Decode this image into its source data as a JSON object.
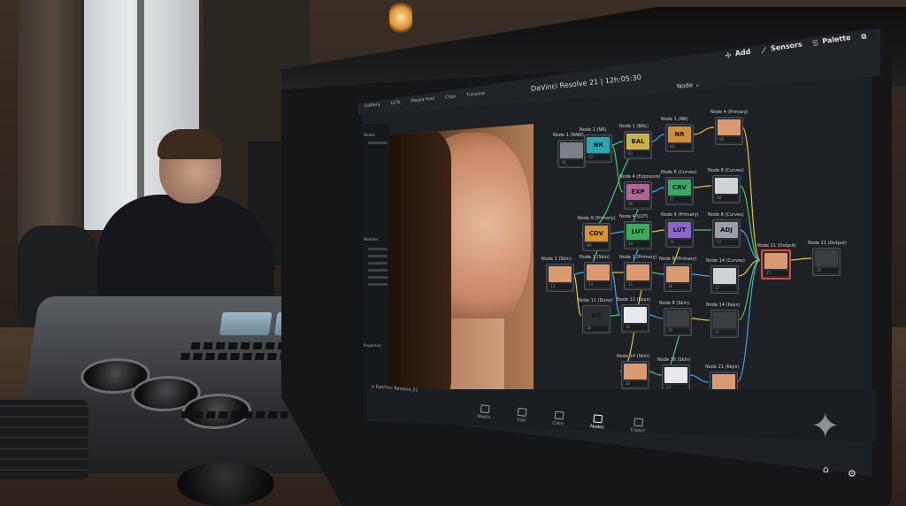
{
  "app": {
    "title": "DaVinci Resolve 21 | 12h:05:30",
    "view_title": "Node",
    "project_name": "DaVinci Resolve 21"
  },
  "menubar": {
    "items": [
      {
        "label": "Add",
        "icon": "plus-icon"
      },
      {
        "label": "Sensors",
        "icon": "sensors-icon"
      },
      {
        "label": "Palette",
        "icon": "palette-icon"
      }
    ]
  },
  "toolbar": {
    "items": [
      "Gallery",
      "LUTs",
      "Media Pool",
      "Clips",
      "Timeline"
    ]
  },
  "sidebar": {
    "header": "Nodes",
    "section_label": "Modules",
    "footer_label": "Properties"
  },
  "nodes": [
    {
      "label": "Node 1 (RAW)",
      "text": "",
      "color": "#7a8085",
      "foot": "01"
    },
    {
      "label": "Node 1 (NR)",
      "text": "NR",
      "color": "#2aa6b0",
      "foot": "02"
    },
    {
      "label": "Node 1 (BAL)",
      "text": "BAL",
      "color": "#c9b24a",
      "foot": "03"
    },
    {
      "label": "Node 1 (NR)",
      "text": "NR",
      "color": "#c9913a",
      "foot": "04"
    },
    {
      "label": "Node 4 (Primary)",
      "text": "",
      "color": "#d99a72",
      "foot": "05"
    },
    {
      "label": "Node 4 (Exposure)",
      "text": "EXP",
      "color": "#b1639a",
      "foot": "06"
    },
    {
      "label": "Node 6 (Curves)",
      "text": "CRV",
      "color": "#3aa865",
      "foot": "07"
    },
    {
      "label": "Node 8 (Curves)",
      "text": "",
      "color": "#cfd3d6",
      "foot": "08"
    },
    {
      "label": "Node 9 (Primary)",
      "text": "CDV",
      "color": "#d39338",
      "foot": "09"
    },
    {
      "label": "Node 4 (LUT)",
      "text": "LUT",
      "color": "#3cab5a",
      "foot": "10"
    },
    {
      "label": "Node 4 (Primary)",
      "text": "LUT",
      "color": "#8b67c8",
      "foot": "11"
    },
    {
      "label": "Node 8 (Curves)",
      "text": "ADJ",
      "color": "#9aa0a5",
      "foot": "12"
    },
    {
      "label": "Node 1 (Skin)",
      "text": "",
      "color": "#d99a72",
      "foot": "13"
    },
    {
      "label": "Node 1 (Skin)",
      "text": "",
      "color": "#d99a72",
      "foot": "14"
    },
    {
      "label": "Node 1 (Primary)",
      "text": "",
      "color": "#d99a72",
      "foot": "15"
    },
    {
      "label": "Node 8 (Primary)",
      "text": "",
      "color": "#d99a72",
      "foot": "16"
    },
    {
      "label": "Node 14 (Curves)",
      "text": "",
      "color": "#cfd3d6",
      "foot": "17"
    },
    {
      "label": "Node 11 (Done)",
      "text": "NS",
      "color": "#2b2f33",
      "foot": "18"
    },
    {
      "label": "Node 11 (Keys)",
      "text": "",
      "color": "#e6e8ea",
      "foot": "19"
    },
    {
      "label": "Node 8 (Skin)",
      "text": "",
      "color": "#3b3f44",
      "foot": "20"
    },
    {
      "label": "Node 14 (Keys)",
      "text": "",
      "color": "#3b3f44",
      "foot": "21"
    },
    {
      "label": "Node 14 (Skin)",
      "text": "",
      "color": "#d99a72",
      "foot": "22"
    },
    {
      "label": "Node 16 (Skin)",
      "text": "",
      "color": "#e6e8ea",
      "foot": "23"
    },
    {
      "label": "Node 21 (Keys)",
      "text": "",
      "color": "#d99a72",
      "foot": "24"
    },
    {
      "label": "Node 21 (Output)",
      "text": "",
      "color": "#d99a72",
      "foot": "25"
    },
    {
      "label": "Node 21 (Output)",
      "text": "",
      "color": "#3b3f44",
      "foot": "26"
    }
  ],
  "pages": [
    {
      "label": "Media",
      "active": false
    },
    {
      "label": "Edit",
      "active": false
    },
    {
      "label": "Color",
      "active": false
    },
    {
      "label": "Nodes",
      "active": true
    },
    {
      "label": "Export",
      "active": false
    }
  ],
  "colors": {
    "accent_yellow": "#e2c43a",
    "accent_blue": "#4aa3e0",
    "accent_green": "#4cc36a",
    "selected_red": "#e0463a"
  }
}
